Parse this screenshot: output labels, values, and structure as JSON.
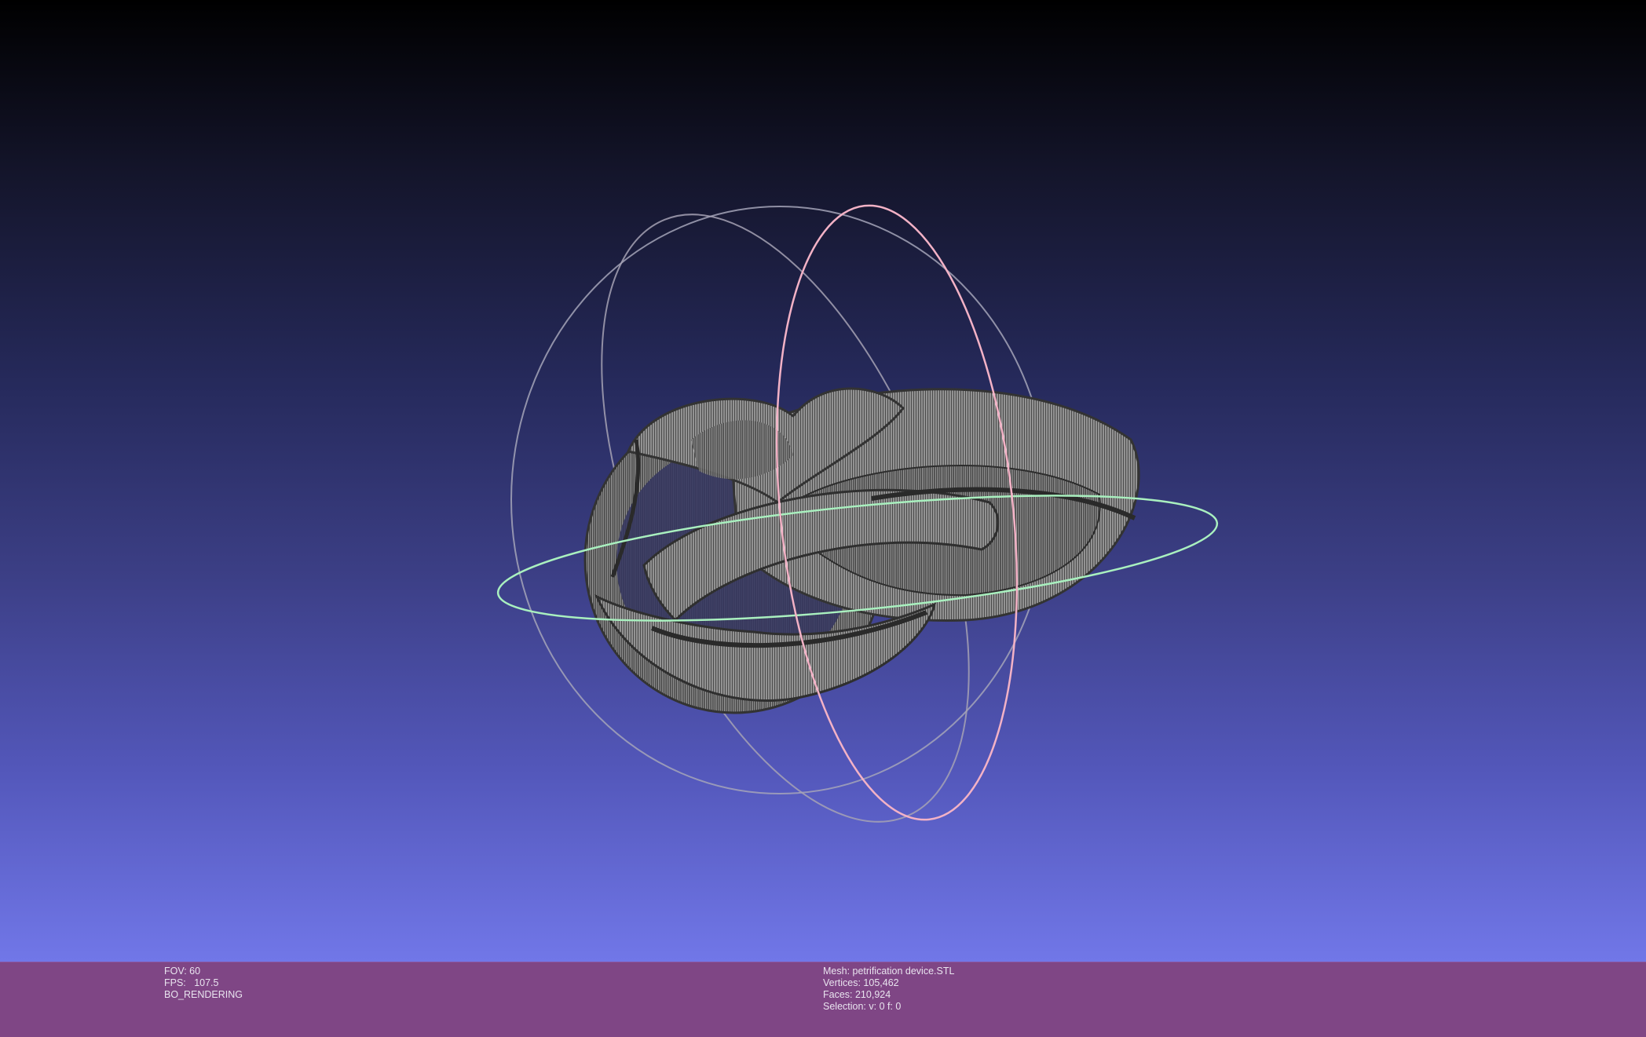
{
  "viewport": {
    "mesh_style": "wireframe",
    "trackball": {
      "colors": {
        "horizontal": "#a9f0bf",
        "vertical": "#f3b2c6",
        "outline": "#a8a8ba"
      }
    },
    "background": {
      "top": "#000000",
      "bottom": "#7177e8"
    }
  },
  "status": {
    "fov": "FOV: 60",
    "fps": "FPS:   107.5",
    "render_mode": "BO_RENDERING",
    "mesh": "Mesh: petrification device.STL",
    "vertices": "Vertices: 105,462",
    "faces": "Faces: 210,924",
    "selection": "Selection: v: 0 f: 0"
  },
  "colors": {
    "statusbar": "#7f4685",
    "mesh": "#4a4a4a",
    "wire": "#e0e0e0"
  }
}
